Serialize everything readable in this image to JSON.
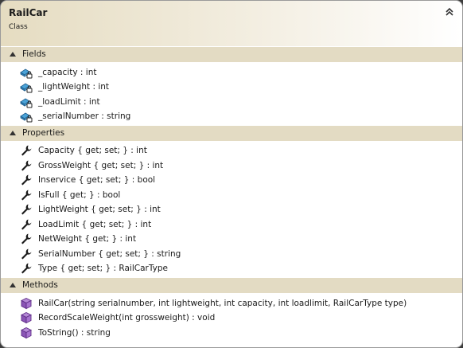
{
  "class_shape": {
    "title": "RailCar",
    "subtitle": "Class"
  },
  "sections": [
    {
      "label": "Fields",
      "icon": "private-field-icon",
      "items": [
        "_capacity : int",
        "_lightWeight : int",
        "_loadLimit : int",
        "_serialNumber : string"
      ]
    },
    {
      "label": "Properties",
      "icon": "property-wrench-icon",
      "items": [
        "Capacity { get; set; } : int",
        "GrossWeight { get; set; } : int",
        "Inservice { get; set; } : bool",
        "IsFull { get; } : bool",
        "LightWeight { get; set; } : int",
        "LoadLimit { get; set; } : int",
        "NetWeight { get; } : int",
        "SerialNumber { get; set; } : string",
        "Type { get; set; } : RailCarType"
      ]
    },
    {
      "label": "Methods",
      "icon": "method-cube-icon",
      "items": [
        "RailCar(string serialnumber, int lightweight, int capacity, int loadlimit, RailCarType type)",
        "RecordScaleWeight(int grossweight) : void",
        "ToString() : string"
      ]
    }
  ]
}
